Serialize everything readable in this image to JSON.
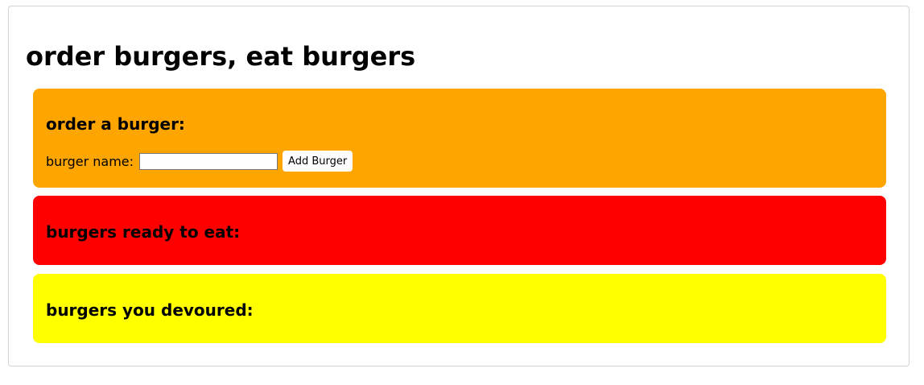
{
  "page": {
    "title": "order burgers, eat burgers"
  },
  "order_panel": {
    "heading": "order a burger:",
    "field_label": "burger name:",
    "input_value": "",
    "input_placeholder": "",
    "button_label": "Add Burger",
    "color": "#ffa500"
  },
  "ready_panel": {
    "heading": "burgers ready to eat:",
    "color": "#ff0000"
  },
  "devoured_panel": {
    "heading": "burgers you devoured:",
    "color": "#ffff00"
  }
}
